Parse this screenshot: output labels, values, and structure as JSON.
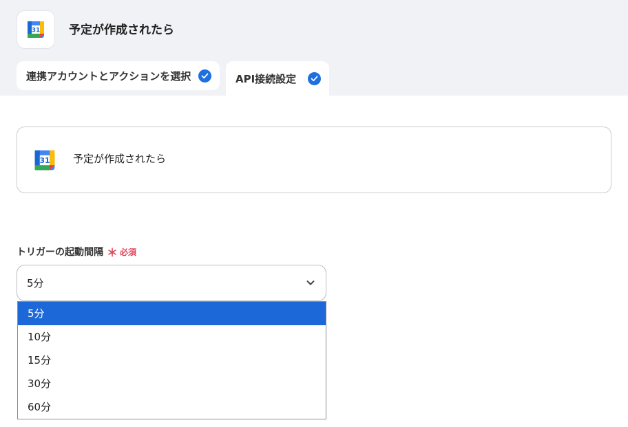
{
  "header": {
    "title": "予定が作成されたら",
    "app_icon": "google-calendar-icon",
    "calendar_day": "31"
  },
  "tabs": [
    {
      "label": "連携アカウントとアクションを選択",
      "completed": true
    },
    {
      "label": "API接続設定",
      "completed": true
    }
  ],
  "trigger_card": {
    "title": "予定が作成されたら",
    "icon": "google-calendar-icon",
    "calendar_day": "31"
  },
  "interval_field": {
    "label": "トリガーの起動間隔",
    "required_mark": "＊",
    "required_text": "必須",
    "value": "5分",
    "options": [
      "5分",
      "10分",
      "15分",
      "30分",
      "60分"
    ],
    "selected_option": "5分"
  },
  "colors": {
    "accent": "#1e6fe0",
    "selected_option_bg": "#1c68d8",
    "required": "#e0455c",
    "top_band": "#f1f2f5"
  }
}
